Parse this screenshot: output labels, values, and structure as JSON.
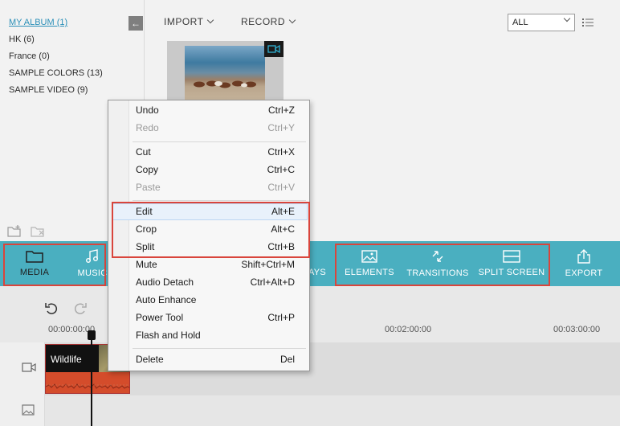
{
  "album": {
    "items": [
      {
        "label": "MY ALBUM (1)"
      },
      {
        "label": "HK (6)"
      },
      {
        "label": "France (0)"
      },
      {
        "label": "SAMPLE COLORS (13)"
      },
      {
        "label": "SAMPLE VIDEO (9)"
      }
    ]
  },
  "header": {
    "import_label": "IMPORT",
    "record_label": "RECORD",
    "filter_value": "ALL"
  },
  "toolbar": {
    "media": "MEDIA",
    "music": "MUSIC",
    "overlays_partial": "AYS",
    "elements": "ELEMENTS",
    "transitions": "TRANSITIONS",
    "split_screen": "SPLIT SCREEN",
    "export": "EXPORT"
  },
  "timeline": {
    "ruler": [
      "00:00:00:00",
      "00:02:00:00",
      "00:03:00:00"
    ],
    "clip_title": "Wildlife"
  },
  "context_menu": {
    "items": [
      {
        "label": "Undo",
        "shortcut": "Ctrl+Z",
        "disabled": false
      },
      {
        "label": "Redo",
        "shortcut": "Ctrl+Y",
        "disabled": true
      },
      {
        "label": "Cut",
        "shortcut": "Ctrl+X",
        "disabled": false
      },
      {
        "label": "Copy",
        "shortcut": "Ctrl+C",
        "disabled": false
      },
      {
        "label": "Paste",
        "shortcut": "Ctrl+V",
        "disabled": true
      },
      {
        "label": "Edit",
        "shortcut": "Alt+E",
        "disabled": false
      },
      {
        "label": "Crop",
        "shortcut": "Alt+C",
        "disabled": false
      },
      {
        "label": "Split",
        "shortcut": "Ctrl+B",
        "disabled": false
      },
      {
        "label": "Mute",
        "shortcut": "Shift+Ctrl+M",
        "disabled": false
      },
      {
        "label": "Audio Detach",
        "shortcut": "Ctrl+Alt+D",
        "disabled": false
      },
      {
        "label": "Auto Enhance",
        "shortcut": "",
        "disabled": false
      },
      {
        "label": "Power Tool",
        "shortcut": "Ctrl+P",
        "disabled": false
      },
      {
        "label": "Flash and Hold",
        "shortcut": "",
        "disabled": false
      },
      {
        "label": "Delete",
        "shortcut": "Del",
        "disabled": false
      }
    ]
  },
  "colors": {
    "toolbar_bg": "#4aafc0",
    "highlight_border": "#d9453c",
    "album_active": "#2a8fb8",
    "clip_bg": "#d44c2b"
  }
}
